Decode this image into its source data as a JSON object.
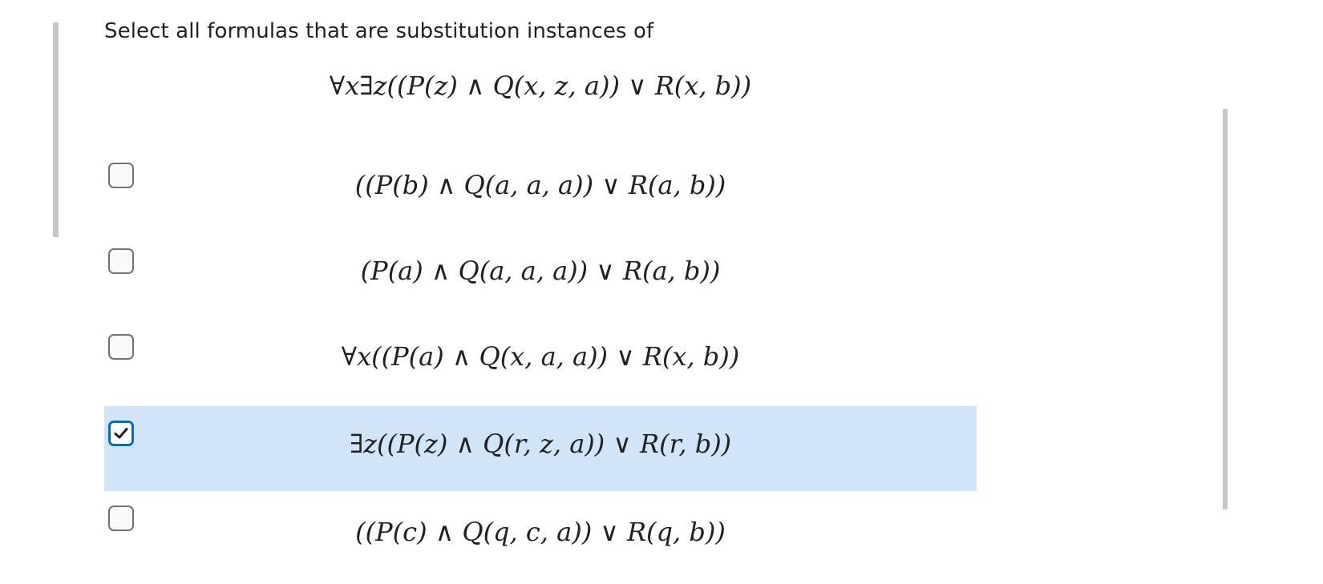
{
  "question": {
    "prompt": "Select all formulas that are substitution instances of",
    "formula": "∀x∃z((P(z) ∧ Q(x, z, a)) ∨ R(x, b))"
  },
  "options": [
    {
      "formula": "((P(b) ∧ Q(a, a, a)) ∨ R(a, b))",
      "checked": false
    },
    {
      "formula": "(P(a) ∧ Q(a, a, a)) ∨ R(a, b))",
      "checked": false
    },
    {
      "formula": "∀x((P(a) ∧ Q(x, a, a)) ∨ R(x, b))",
      "checked": false
    },
    {
      "formula": "∃z((P(z) ∧ Q(r, z, a)) ∨ R(r, b))",
      "checked": true
    },
    {
      "formula": "((P(c) ∧ Q(q, c, a)) ∨ R(q, b))",
      "checked": false
    }
  ],
  "colors": {
    "selected_row": "#d2e5f8",
    "checkbox_checked_border": "#006fbf",
    "checkmark": "#202122"
  }
}
